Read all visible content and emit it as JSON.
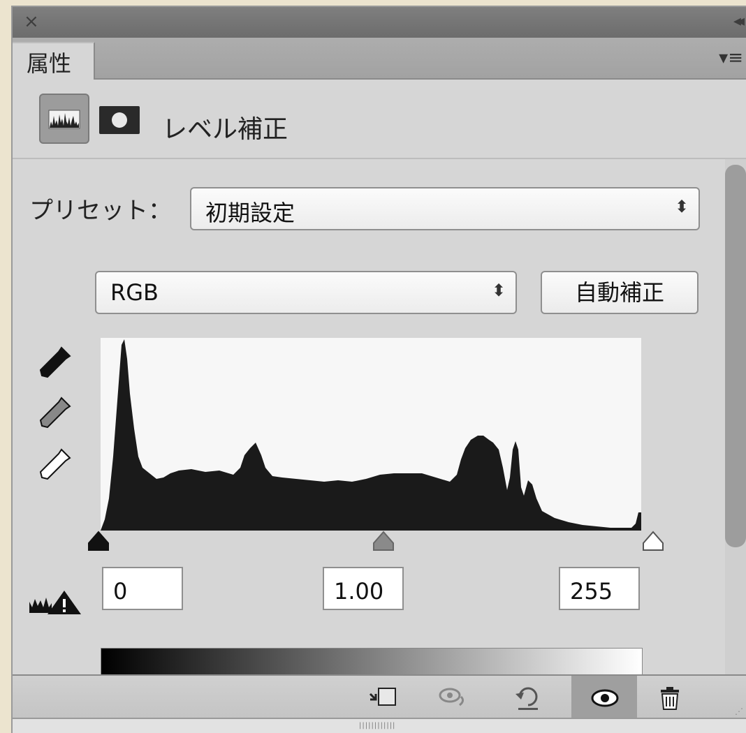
{
  "titlebar": {
    "close_icon": "close-icon",
    "collapse_icon": "double-chevron-icon"
  },
  "tab": {
    "label": "属性",
    "menu_icon": "panel-menu-icon"
  },
  "header": {
    "title": "レベル補正",
    "icons": [
      "histogram-icon",
      "mask-icon"
    ]
  },
  "preset": {
    "label": "プリセット：",
    "value": "初期設定"
  },
  "channel": {
    "value": "RGB"
  },
  "auto_button": {
    "label": "自動補正"
  },
  "eyedroppers": [
    "black-eyedropper-icon",
    "gray-eyedropper-icon",
    "white-eyedropper-icon"
  ],
  "input_levels": {
    "black": "0",
    "gamma": "1.00",
    "white": "255"
  },
  "footer": {
    "icons": [
      "clip-to-layer-icon",
      "view-previous-icon",
      "reset-icon",
      "visibility-eye-icon",
      "trash-icon"
    ]
  },
  "colors": {
    "panel_bg": "#d6d6d6",
    "histogram_fill": "#1a1a1a",
    "active_button": "#9f9f9f"
  }
}
